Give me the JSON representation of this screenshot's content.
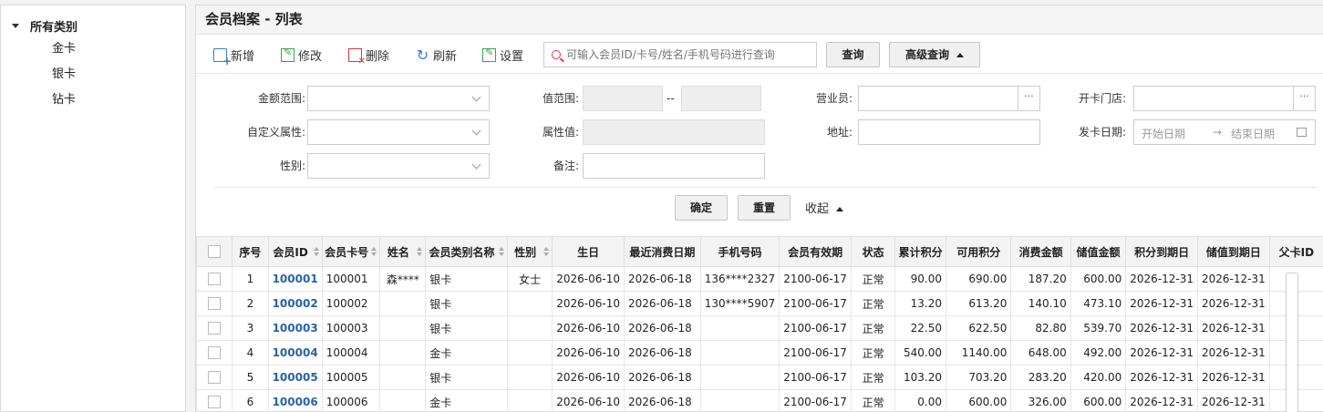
{
  "sidebar": {
    "root": "所有类别",
    "items": [
      {
        "label": "金卡"
      },
      {
        "label": "银卡"
      },
      {
        "label": "钻卡"
      }
    ]
  },
  "header": {
    "title": "会员档案 - 列表"
  },
  "toolbar": {
    "new": "新增",
    "edit": "修改",
    "delete": "删除",
    "refresh": "刷新",
    "settings": "设置",
    "search_placeholder": "可输入会员ID/卡号/姓名/手机号码进行查询",
    "query": "查询",
    "advanced": "高级查询"
  },
  "filters": {
    "amount_range": "金额范围:",
    "value_range": "值范围:",
    "range_sep": "--",
    "sales": "营业员:",
    "store": "开卡门店:",
    "custom_attr": "自定义属性:",
    "attr_value": "属性值:",
    "address": "地址:",
    "issue_date": "发卡日期:",
    "start_date": "开始日期",
    "date_arrow": "→",
    "end_date": "结束日期",
    "gender": "性别:",
    "remark": "备注:",
    "dots": "···",
    "confirm": "确定",
    "reset": "重置",
    "collapse": "收起"
  },
  "table": {
    "columns": [
      "序号",
      "会员ID",
      "会员卡号",
      "姓名",
      "会员类别名称",
      "性别",
      "生日",
      "最近消费日期",
      "手机号码",
      "会员有效期",
      "状态",
      "累计积分",
      "可用积分",
      "消费金额",
      "储值金额",
      "积分到期日",
      "储值到期日",
      "父卡ID"
    ],
    "rows": [
      [
        "1",
        "100001",
        "100001",
        "森****",
        "银卡",
        "女士",
        "2026-06-10",
        "2026-06-18",
        "136****2327",
        "2100-06-17",
        "正常",
        "90.00",
        "690.00",
        "187.20",
        "600.00",
        "2026-12-31",
        "2026-12-31",
        ""
      ],
      [
        "2",
        "100002",
        "100002",
        "",
        "银卡",
        "",
        "2026-06-10",
        "2026-06-18",
        "130****5907",
        "2100-06-17",
        "正常",
        "13.20",
        "613.20",
        "140.10",
        "473.10",
        "2026-12-31",
        "2026-12-31",
        ""
      ],
      [
        "3",
        "100003",
        "100003",
        "",
        "银卡",
        "",
        "2026-06-10",
        "2026-06-18",
        "",
        "2100-06-17",
        "正常",
        "22.50",
        "622.50",
        "82.80",
        "539.70",
        "2026-12-31",
        "2026-12-31",
        ""
      ],
      [
        "4",
        "100004",
        "100004",
        "",
        "金卡",
        "",
        "2026-06-10",
        "2026-06-18",
        "",
        "2100-06-17",
        "正常",
        "540.00",
        "1140.00",
        "648.00",
        "492.00",
        "2026-12-31",
        "2026-12-31",
        ""
      ],
      [
        "5",
        "100005",
        "100005",
        "",
        "银卡",
        "",
        "2026-06-10",
        "2026-06-18",
        "",
        "2100-06-17",
        "正常",
        "103.20",
        "703.20",
        "283.20",
        "420.00",
        "2026-12-31",
        "2026-12-31",
        ""
      ],
      [
        "6",
        "100006",
        "100006",
        "",
        "金卡",
        "",
        "2026-06-10",
        "2026-06-18",
        "",
        "2100-06-17",
        "正常",
        "0.00",
        "600.00",
        "326.00",
        "600.00",
        "2026-12-31",
        "2026-12-31",
        ""
      ]
    ]
  }
}
